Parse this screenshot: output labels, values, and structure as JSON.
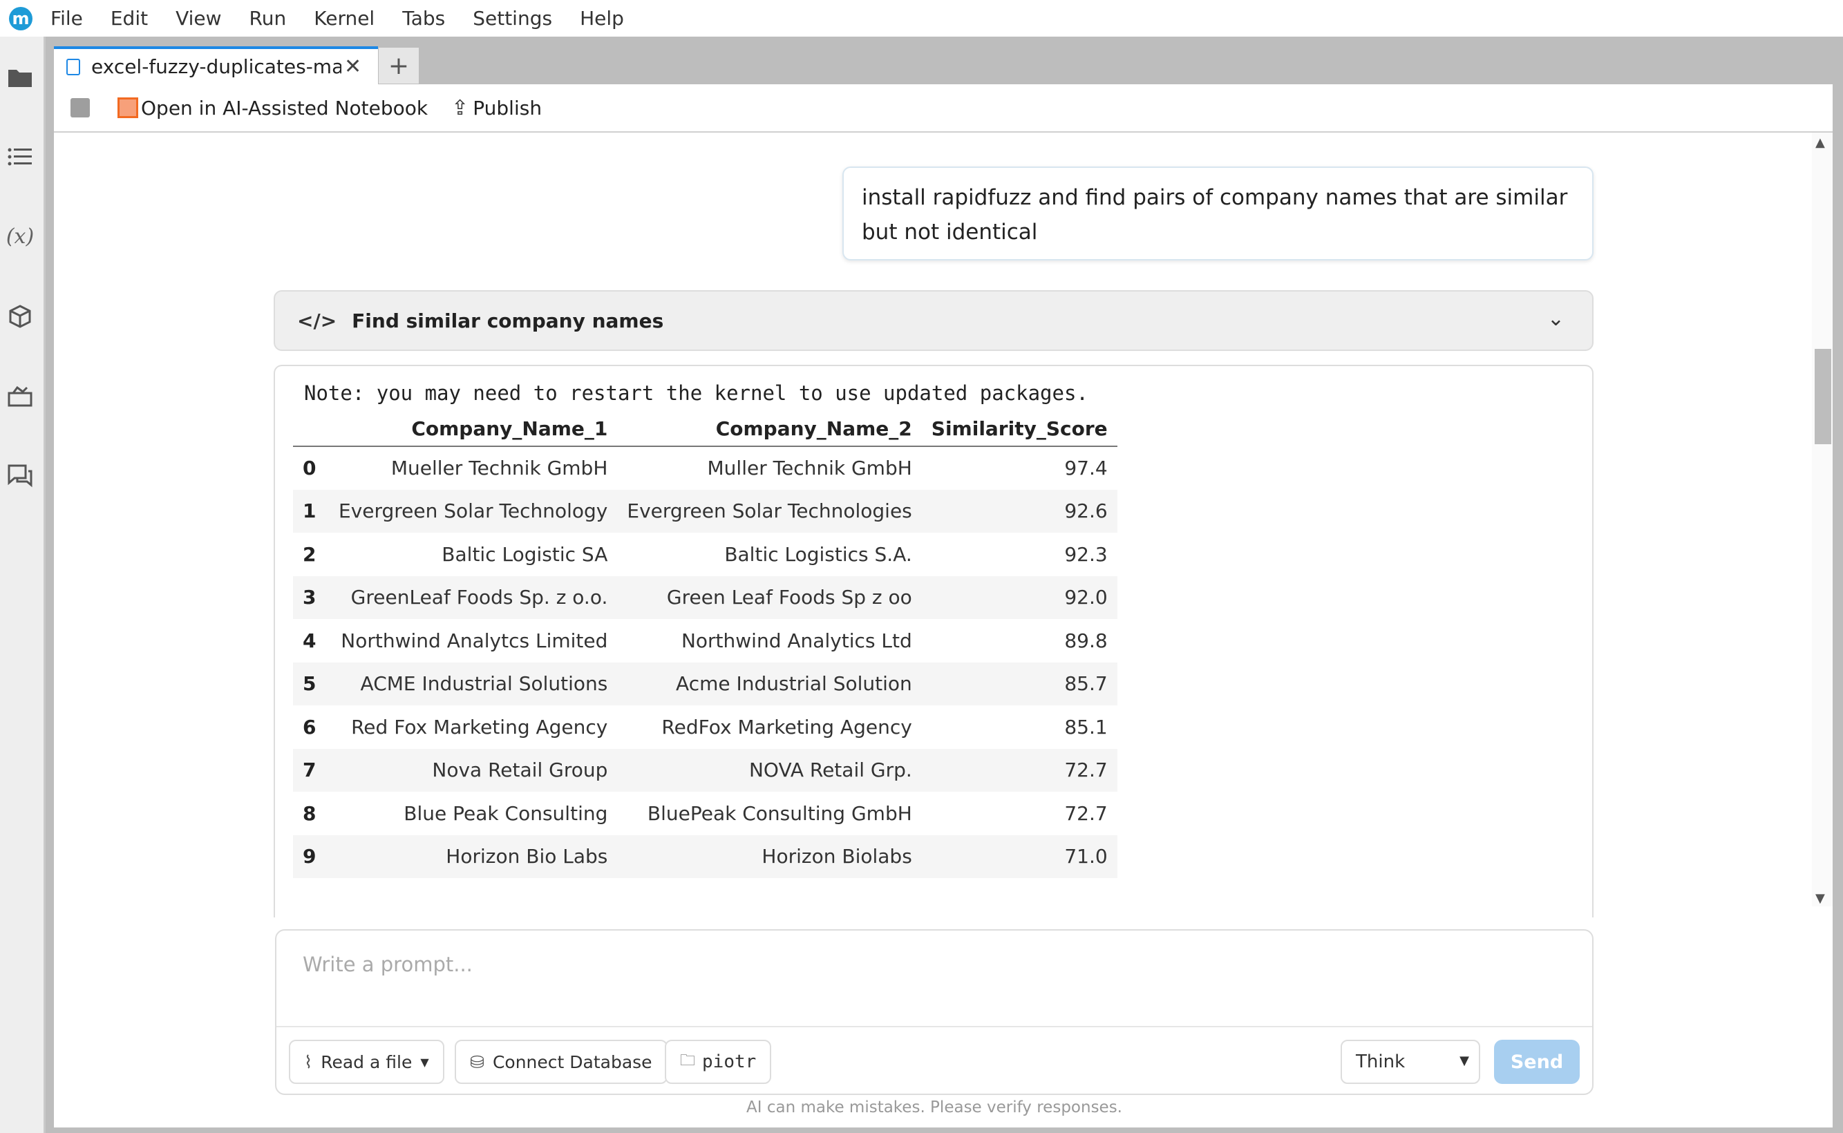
{
  "menubar": {
    "logo": "m",
    "items": [
      "File",
      "Edit",
      "View",
      "Run",
      "Kernel",
      "Tabs",
      "Settings",
      "Help"
    ]
  },
  "tab": {
    "title": "excel-fuzzy-duplicates-match",
    "close": "✕",
    "add": "+"
  },
  "toolbar": {
    "open_ai": "Open in AI-Assisted Notebook",
    "publish": "Publish"
  },
  "chat": {
    "user_message": "install rapidfuzz and find pairs of company names that are similar but not identical",
    "code_icon": "</>",
    "code_title": "Find similar company names",
    "note": "Note: you may need to restart the kernel to use updated packages."
  },
  "table": {
    "headers": [
      "",
      "Company_Name_1",
      "Company_Name_2",
      "Similarity_Score"
    ],
    "rows": [
      [
        "0",
        "Mueller Technik GmbH",
        "Muller Technik GmbH",
        "97.4"
      ],
      [
        "1",
        "Evergreen Solar Technology",
        "Evergreen Solar Technologies",
        "92.6"
      ],
      [
        "2",
        "Baltic Logistic SA",
        "Baltic Logistics S.A.",
        "92.3"
      ],
      [
        "3",
        "GreenLeaf Foods Sp. z o.o.",
        "Green Leaf Foods Sp z oo",
        "92.0"
      ],
      [
        "4",
        "Northwind Analytcs Limited",
        "Northwind Analytics Ltd",
        "89.8"
      ],
      [
        "5",
        "ACME Industrial Solutions",
        "Acme Industrial Solution",
        "85.7"
      ],
      [
        "6",
        "Red Fox Marketing Agency",
        "RedFox Marketing Agency",
        "85.1"
      ],
      [
        "7",
        "Nova Retail Group",
        "NOVA Retail Grp.",
        "72.7"
      ],
      [
        "8",
        "Blue Peak Consulting",
        "BluePeak Consulting GmbH",
        "72.7"
      ],
      [
        "9",
        "Horizon Bio Labs",
        "Horizon Biolabs",
        "71.0"
      ]
    ]
  },
  "prompt": {
    "placeholder": "Write a prompt...",
    "read_file": "Read a file",
    "connect_db": "Connect Database",
    "folder": "piotr",
    "mode": "Think",
    "send": "Send",
    "disclaimer": "AI can make mistakes. Please verify responses."
  }
}
